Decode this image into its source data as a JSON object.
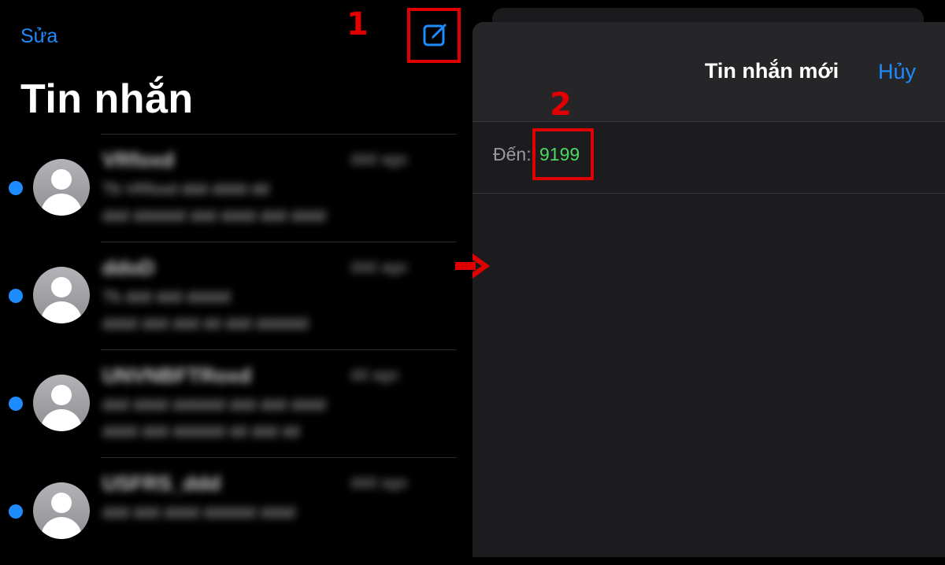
{
  "left": {
    "edit_label": "Sửa",
    "title": "Tin nhắn",
    "conversations": [
      {
        "name": "VRfoxd",
        "time": "ddd ago",
        "line1": "Tb VRfoxd ddd dddd dd",
        "line2": "ddd dddddd ddd dddd ddd dddd",
        "unread": true
      },
      {
        "name": "ddoD",
        "time": "ddd ago",
        "line1": "Tb ddd ddd ddddd",
        "line2": "dddd ddd ddd dd ddd dddddd",
        "unread": true
      },
      {
        "name": "UNVNBFTRoxd",
        "time": "dd ago",
        "line1": "ddd dddd dddddd ddd ddd dddd",
        "line2": "dddd ddd dddddd dd ddd dd",
        "unread": true
      },
      {
        "name": "USFRS_ddd",
        "time": "ddd ago",
        "line1": "ddd ddd dddd dddddd dddd",
        "line2": "dddd ddd ddddd dd dddd",
        "unread": true
      }
    ]
  },
  "annotations": {
    "step1": "1",
    "step2": "2"
  },
  "sheet": {
    "title": "Tin nhắn mới",
    "cancel_label": "Hủy",
    "to_label": "Đến:",
    "to_value": "9199"
  },
  "colors": {
    "accent": "#1e8bff",
    "annotation": "#e00000",
    "number_green": "#4cd964"
  },
  "icons": {
    "compose": "compose-icon",
    "avatar": "person-icon",
    "arrow": "arrow-right-icon"
  }
}
